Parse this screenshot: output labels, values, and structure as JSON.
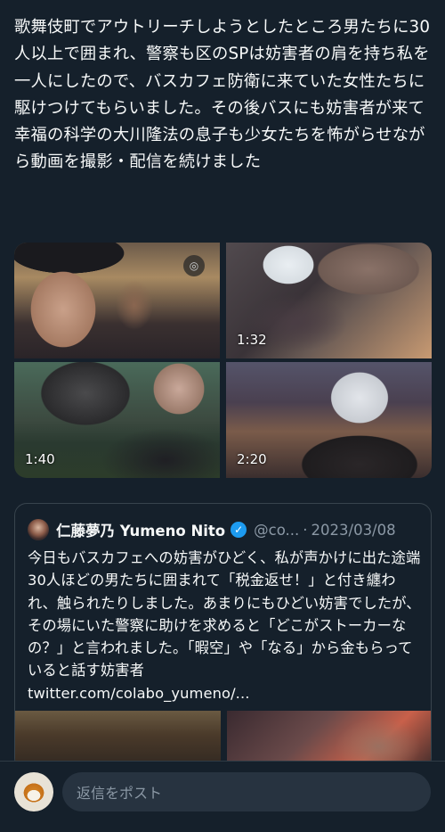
{
  "post": {
    "text": "歌舞伎町でアウトリーチしようとしたところ男たちに30人以上で囲まれ、警察も区のSPは妨害者の肩を持ち私を一人にしたので、バスカフェ防衛に来ていた女性たちに駆けつけてもらいました。その後バスにも妨害者が来て幸福の科学の大川隆法の息子も少女たちを怖がらせながら動画を撮影・配信を続けました"
  },
  "media": {
    "tiles": [
      {
        "duration": "",
        "badge": "gif"
      },
      {
        "duration": "1:32"
      },
      {
        "duration": "1:40"
      },
      {
        "duration": "2:20"
      }
    ]
  },
  "quote": {
    "display_name": "仁藤夢乃  Yumeno Nito",
    "handle": "@co...",
    "separator": "·",
    "date": "2023/03/08",
    "verified_icon": "verified-badge-icon",
    "text": "今日もバスカフェへの妨害がひどく、私が声かけに出た途端30人ほどの男たちに囲まれて「税金返せ！」と付き纏われ、触られたりしました。あまりにもひどい妨害でしたが、その場にいた警察に助けを求めると「どこがストーカーなの？」と言われました。「暇空」や「なる」から金もらっていると話す妨害者\ntwitter.com/colabo_yumeno/..."
  },
  "reply": {
    "placeholder": "返信をポスト"
  },
  "colors": {
    "background": "#15202b",
    "text": "#f7f9f9",
    "secondary": "#8b98a5",
    "accent": "#1d9bf0",
    "border": "#38444d"
  }
}
